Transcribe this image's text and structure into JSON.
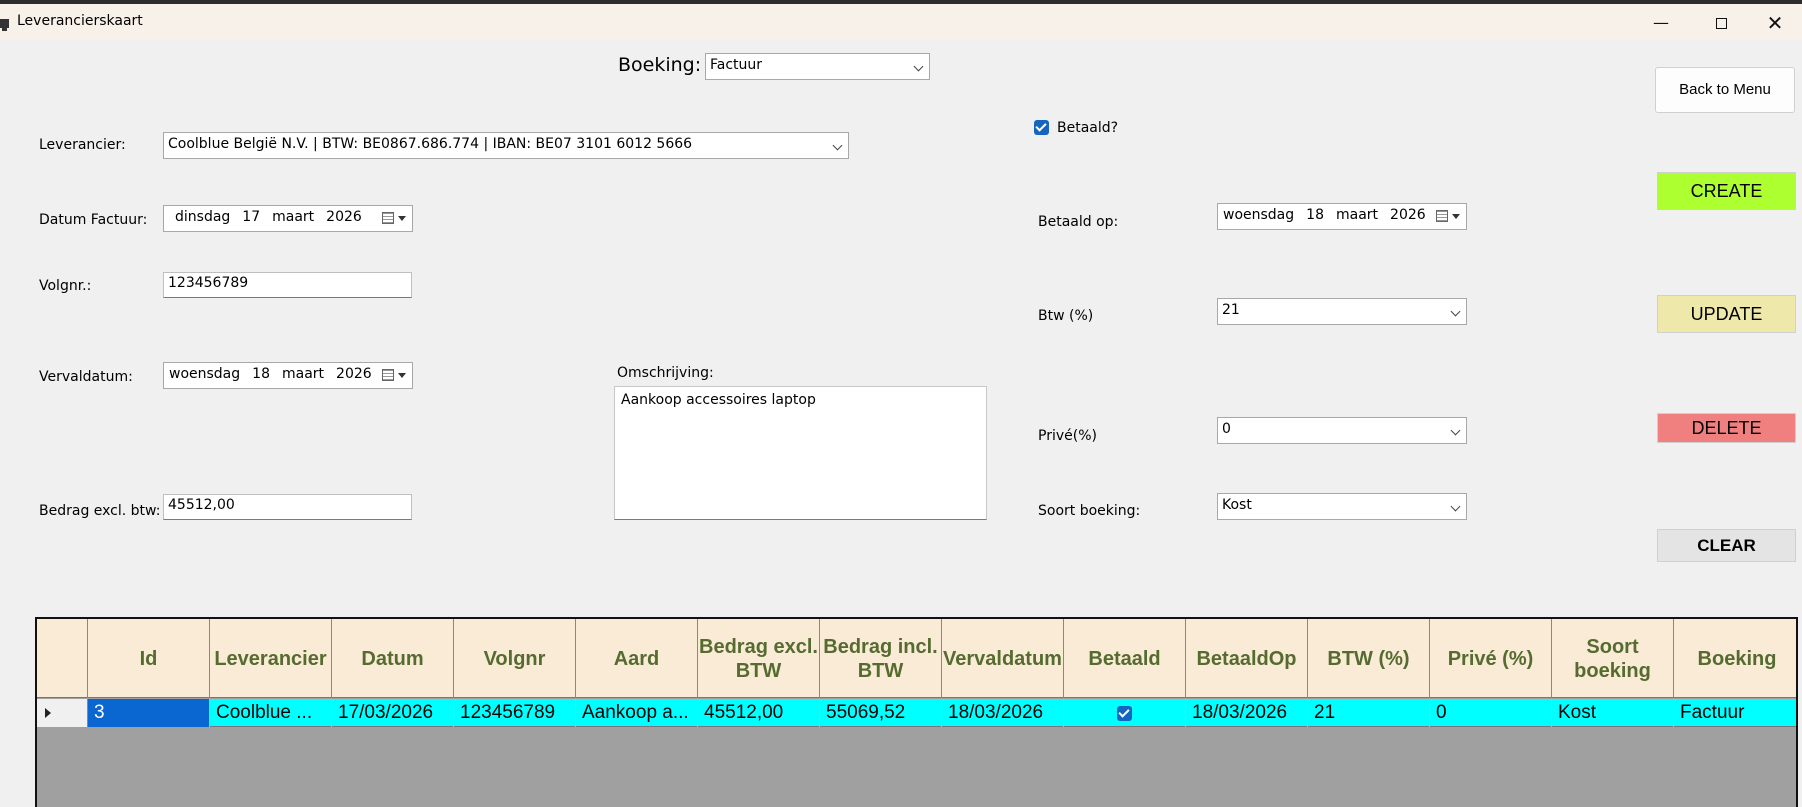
{
  "window": {
    "title": "Leverancierskaart",
    "minimize": "—",
    "close": "✕"
  },
  "boeking": {
    "label": "Boeking:",
    "value": "Factuur"
  },
  "leverancier": {
    "label": "Leverancier:",
    "value": "Coolblue België N.V. | BTW: BE0867.686.774 | IBAN: BE07 3101 6012 5666"
  },
  "datum_factuur": {
    "label": "Datum Factuur:",
    "weekday": "dinsdag",
    "day": "17",
    "month": "maart",
    "year": "2026"
  },
  "volgnr": {
    "label": "Volgnr.:",
    "value": "123456789"
  },
  "vervaldatum": {
    "label": "Vervaldatum:",
    "weekday": "woensdag",
    "day": "18",
    "month": "maart",
    "year": "2026"
  },
  "omschrijving": {
    "label": "Omschrijving:",
    "value": "Aankoop accessoires laptop"
  },
  "bedrag_excl": {
    "label": "Bedrag excl. btw:",
    "value": "45512,00"
  },
  "betaald": {
    "label": "Betaald?",
    "checked": true
  },
  "betaald_op": {
    "label": "Betaald op:",
    "weekday": "woensdag",
    "day": "18",
    "month": "maart",
    "year": "2026"
  },
  "btw": {
    "label": "Btw (%)",
    "value": "21"
  },
  "prive": {
    "label": "Privé(%)",
    "value": "0"
  },
  "soort_boeking": {
    "label": "Soort boeking:",
    "value": "Kost"
  },
  "buttons": {
    "back": "Back to Menu",
    "create": "CREATE",
    "update": "UPDATE",
    "delete": "DELETE",
    "clear": "CLEAR"
  },
  "colors": {
    "create": "#adff2f",
    "update": "#eee8aa",
    "delete": "#f08080",
    "grid_header_bg": "#faebd7",
    "grid_header_text": "#556b2f",
    "grid_row_bg": "#00ffff",
    "grid_selection": "#0a66d0"
  },
  "grid": {
    "columns": [
      "Id",
      "Leverancier",
      "Datum",
      "Volgnr",
      "Aard",
      "Bedrag excl. BTW",
      "Bedrag incl. BTW",
      "Vervaldatum",
      "Betaald",
      "BetaaldOp",
      "BTW (%)",
      "Privé (%)",
      "Soort boeking",
      "Boeking"
    ],
    "rows": [
      {
        "id": "3",
        "leverancier": "Coolblue ...",
        "datum": "17/03/2026",
        "volgnr": "123456789",
        "aard": "Aankoop a...",
        "bedrag_excl": "45512,00",
        "bedrag_incl": "55069,52",
        "vervaldatum": "18/03/2026",
        "betaald": true,
        "betaald_op": "18/03/2026",
        "btw": "21",
        "prive": "0",
        "soort": "Kost",
        "boeking": "Factuur"
      }
    ]
  }
}
